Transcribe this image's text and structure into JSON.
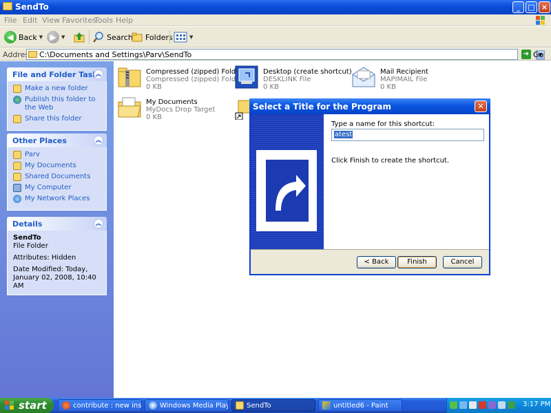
{
  "window": {
    "title": "SendTo"
  },
  "menu": [
    "File",
    "Edit",
    "View",
    "Favorites",
    "Tools",
    "Help"
  ],
  "toolbar": {
    "back": "Back",
    "search": "Search",
    "folders": "Folders"
  },
  "address": {
    "label": "Address",
    "value": "C:\\Documents and Settings\\Parv\\SendTo",
    "go": "Go"
  },
  "tasks": {
    "file_folder": {
      "header": "File and Folder Tasks",
      "items": [
        "Make a new folder",
        "Publish this folder to the Web",
        "Share this folder"
      ]
    },
    "other_places": {
      "header": "Other Places",
      "items": [
        "Parv",
        "My Documents",
        "Shared Documents",
        "My Computer",
        "My Network Places"
      ]
    },
    "details": {
      "header": "Details",
      "name": "SendTo",
      "type": "File Folder",
      "attributes": "Attributes: Hidden",
      "modified": "Date Modified: Today, January 02, 2008, 10:40 AM"
    }
  },
  "files": [
    {
      "name": "Compressed (zipped) Folder",
      "type": "Compressed (zipped) Folder S...",
      "size": "0 KB",
      "icon": "zip-folder-icon"
    },
    {
      "name": "Desktop (create shortcut)",
      "type": "DESKLINK File",
      "size": "0 KB",
      "icon": "desktop-shortcut-icon"
    },
    {
      "name": "Mail Recipient",
      "type": "MAPIMAIL File",
      "size": "0 KB",
      "icon": "mail-envelope-icon"
    },
    {
      "name": "My Documents",
      "type": "MyDocs Drop Target",
      "size": "0 KB",
      "icon": "my-documents-icon"
    }
  ],
  "dialog": {
    "title": "Select a Title for the Program",
    "prompt": "Type a name for this shortcut:",
    "input_value": "atest",
    "hint": "Click Finish to create the shortcut.",
    "back": "< Back",
    "finish": "Finish",
    "cancel": "Cancel"
  },
  "taskbar": {
    "start": "start",
    "tasks": [
      "contribute : new instr...",
      "Windows Media Player",
      "SendTo",
      "untitled6 - Paint"
    ],
    "clock": "3:17 PM"
  },
  "colors": {
    "xp_blue": "#0a4cd8",
    "task_pane_blue": "#6375d6",
    "start_green": "#2f8b2f",
    "link_blue": "#215dc6"
  }
}
